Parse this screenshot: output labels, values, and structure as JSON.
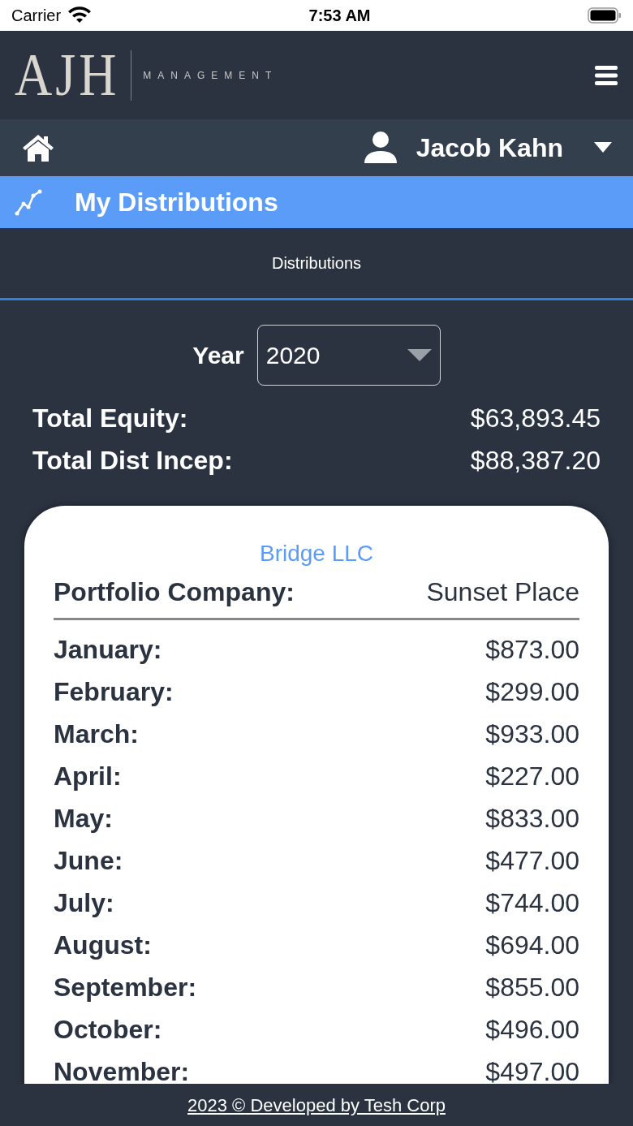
{
  "status_bar": {
    "carrier": "Carrier",
    "time": "7:53 AM"
  },
  "header": {
    "logo_initials": "AJH",
    "logo_word": "MANAGEMENT"
  },
  "user_bar": {
    "user_name": "Jacob Kahn"
  },
  "page_title": "My Distributions",
  "tabs": [
    {
      "label": "Distributions",
      "selected": true
    }
  ],
  "year": {
    "label": "Year",
    "value": "2020"
  },
  "totals": [
    {
      "label": "Total Equity:",
      "value": "$63,893.45"
    },
    {
      "label": "Total Dist Incep:",
      "value": "$88,387.20"
    }
  ],
  "card": {
    "title": "Bridge LLC",
    "company_label": "Portfolio Company:",
    "company_value": "Sunset Place",
    "months": [
      {
        "label": "January:",
        "value": "$873.00"
      },
      {
        "label": "February:",
        "value": "$299.00"
      },
      {
        "label": "March:",
        "value": "$933.00"
      },
      {
        "label": "April:",
        "value": "$227.00"
      },
      {
        "label": "May:",
        "value": "$833.00"
      },
      {
        "label": "June:",
        "value": "$477.00"
      },
      {
        "label": "July:",
        "value": "$744.00"
      },
      {
        "label": "August:",
        "value": "$694.00"
      },
      {
        "label": "September:",
        "value": "$855.00"
      },
      {
        "label": "October:",
        "value": "$496.00"
      },
      {
        "label": "November:",
        "value": "$497.00"
      }
    ]
  },
  "footer": "2023 © Developed by Tesh Corp"
}
